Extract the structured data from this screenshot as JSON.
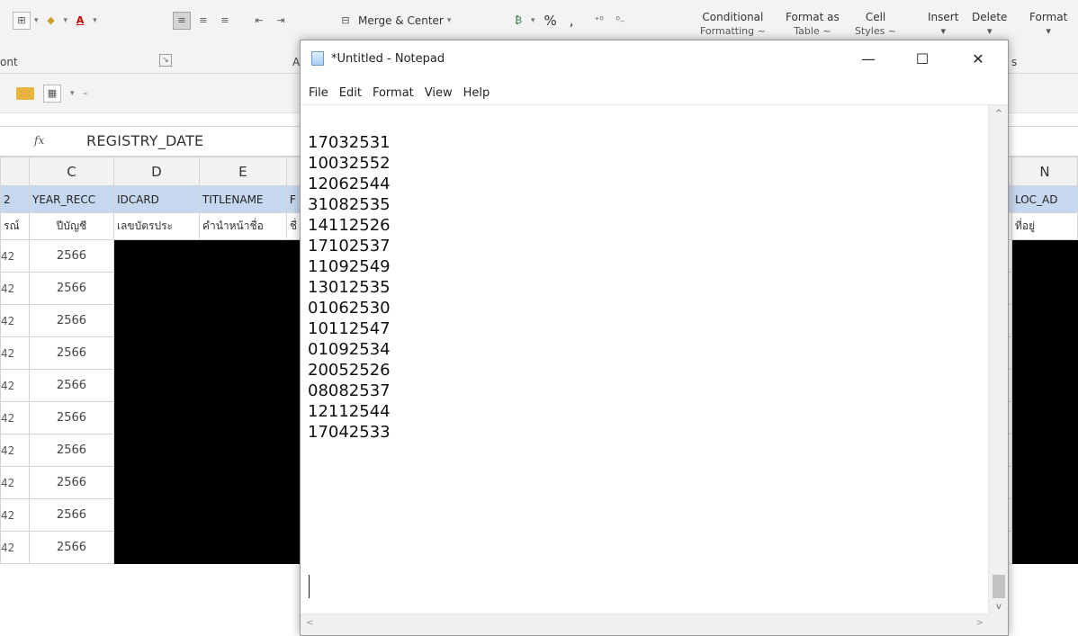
{
  "excel": {
    "ribbon": {
      "merge_center_label": "Merge & Center",
      "percent_label": "%",
      "comma_label": ",",
      "conditional_formatting": {
        "line1": "Conditional",
        "line2": "Formatting ~"
      },
      "format_as_table": {
        "line1": "Format as",
        "line2": "Table ~"
      },
      "cell_styles": {
        "line1": "Cell",
        "line2": "Styles ~"
      },
      "insert_label": "Insert",
      "delete_label": "Delete",
      "format_label": "Format",
      "font_group_label": "ont",
      "alignment_group_label": "A",
      "styles_group_label": "s"
    },
    "formula_bar": {
      "fx_label": "fx",
      "content": "REGISTRY_DATE"
    },
    "column_headers": [
      "C",
      "D",
      "E",
      "N"
    ],
    "row_field_names": {
      "c0": "2",
      "c1": "YEAR_RECC",
      "c2": "IDCARD",
      "c3": "TITLENAME",
      "c3b": "F",
      "n": "LOC_AD"
    },
    "row_thai_headers": {
      "c0": "รณ์",
      "c1": "ปีบัญชี",
      "c2": "เลขบัตรประ",
      "c3": "คำนำหน้าชื่อ",
      "c3b": "ชื่",
      "n": "ที่อยู่"
    },
    "data_rows": [
      {
        "rownum": "42",
        "year": "2566"
      },
      {
        "rownum": "42",
        "year": "2566"
      },
      {
        "rownum": "42",
        "year": "2566"
      },
      {
        "rownum": "42",
        "year": "2566"
      },
      {
        "rownum": "42",
        "year": "2566"
      },
      {
        "rownum": "42",
        "year": "2566"
      },
      {
        "rownum": "42",
        "year": "2566"
      },
      {
        "rownum": "42",
        "year": "2566"
      },
      {
        "rownum": "42",
        "year": "2566"
      },
      {
        "rownum": "42",
        "year": "2566"
      }
    ]
  },
  "notepad": {
    "title": "*Untitled - Notepad",
    "window_buttons": {
      "minimize": "—",
      "maximize": "☐",
      "close": "✕"
    },
    "menu": [
      "File",
      "Edit",
      "Format",
      "View",
      "Help"
    ],
    "lines": [
      "17032531",
      "10032552",
      "12062544",
      "31082535",
      "14112526",
      "17102537",
      "11092549",
      "13012535",
      "01062530",
      "10112547",
      "01092534",
      "20052526",
      "08082537",
      "12112544",
      "17042533"
    ],
    "colors": {
      "accent": "#0078d7",
      "header_row": "#c6d8ef",
      "redacted": "#000000"
    }
  }
}
